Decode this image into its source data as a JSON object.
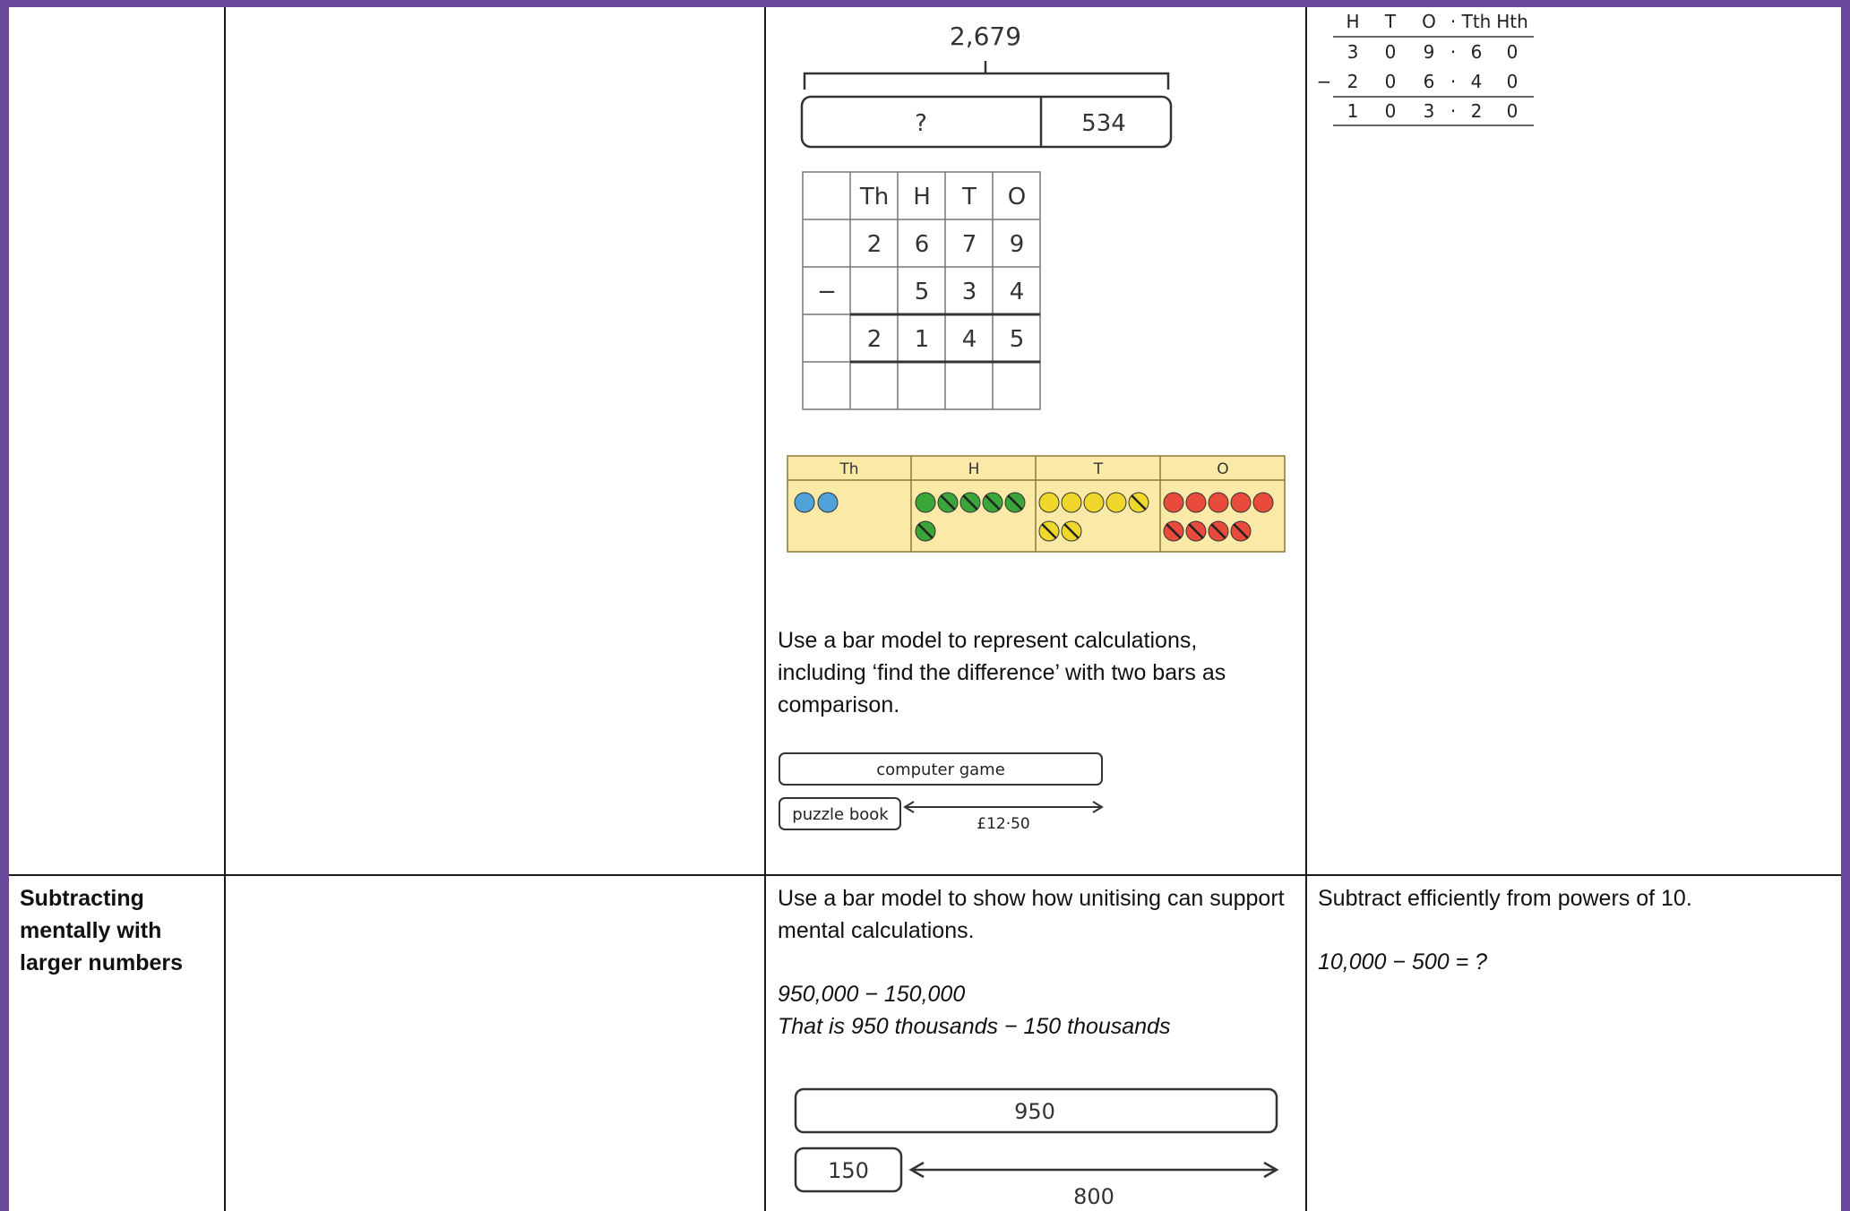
{
  "row1": {
    "bar_top": {
      "total": "2,679",
      "unknown": "?",
      "part": "534"
    },
    "column_subtraction": {
      "headers": [
        "Th",
        "H",
        "T",
        "O"
      ],
      "row1": [
        "2",
        "6",
        "7",
        "9"
      ],
      "operator": "−",
      "row2": [
        "",
        "5",
        "3",
        "4"
      ],
      "row3": [
        "2",
        "1",
        "4",
        "5"
      ]
    },
    "counters": {
      "headers": [
        "Th",
        "H",
        "T",
        "O"
      ]
    },
    "bar_model_text": "Use a bar model to represent calculations, including ‘find the difference’ with two bars as comparison.",
    "comparison_bar": {
      "long": "computer game",
      "short": "puzzle book",
      "difference": "£12·50"
    },
    "decimal_subtraction": {
      "headers": [
        "H",
        "T",
        "O",
        "·",
        "Tth",
        "Hth"
      ],
      "row1": [
        "3",
        "0",
        "9",
        "·",
        "6",
        "0"
      ],
      "operator": "−",
      "row2": [
        "2",
        "0",
        "6",
        "·",
        "4",
        "0"
      ],
      "row3": [
        "1",
        "0",
        "3",
        "·",
        "2",
        "0"
      ]
    }
  },
  "row2": {
    "heading": "Subtracting mentally with larger numbers",
    "col3_text": "Use a bar model to show how unitising can support mental calculations.",
    "col3_calc": "950,000 − 150,000",
    "col3_calc2": "That is 950 thousands − 150 thousands",
    "bar": {
      "long": "950",
      "short": "150",
      "difference": "800"
    },
    "col4_text": "Subtract efficiently from powers of 10.",
    "col4_calc": "10,000 − 500 = ?"
  },
  "colors": {
    "frame": "#67489b",
    "counter_bg": "#fbeaa7",
    "thousand": "#4fa3d9",
    "hundred": "#3aa63a",
    "ten": "#f0d72c",
    "one": "#e84a3c"
  }
}
